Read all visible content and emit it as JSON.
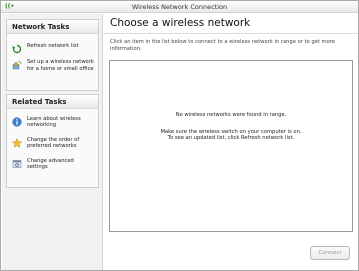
{
  "window": {
    "title": "Wireless Network Connection",
    "title_icon": "wireless-icon"
  },
  "left_pane": {
    "network_tasks": {
      "header": "Network Tasks",
      "items": [
        {
          "label": "Refresh network list",
          "icon": "refresh-icon"
        },
        {
          "label": "Set up a wireless network for a home or small office",
          "icon": "setup-network-icon"
        }
      ]
    },
    "related_tasks": {
      "header": "Related Tasks",
      "items": [
        {
          "label": "Learn about wireless networking",
          "icon": "info-icon"
        },
        {
          "label": "Change the order of preferred networks",
          "icon": "star-icon"
        },
        {
          "label": "Change advanced settings",
          "icon": "settings-icon"
        }
      ]
    }
  },
  "main": {
    "heading": "Choose a wireless network",
    "instructions": "Click an item in the list below to connect to a wireless network in range or to get more information.",
    "list": {
      "empty_message": "No wireless networks were found in range.",
      "hint_line1": "Make sure the wireless switch on your computer is on.",
      "hint_line2": "To see an updated list, click  Refresh network list."
    },
    "connect_label": "Connect"
  },
  "colors": {
    "accent_green": "#2f8a2f",
    "pane_background": "#f1f1f1",
    "disabled_text": "#9a9a9a"
  }
}
